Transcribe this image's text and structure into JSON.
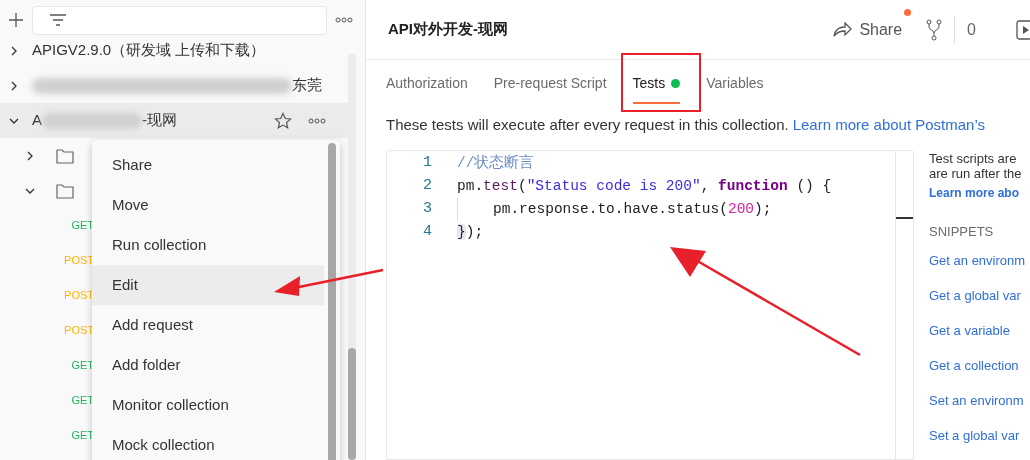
{
  "sidebar": {
    "collections": [
      {
        "name": "APIGV2.9.0（研发域 上传和下载）",
        "expanded": false,
        "selected": false
      },
      {
        "name": "东莞",
        "blurred": true,
        "expanded": false,
        "selected": false
      },
      {
        "name": "A",
        "suffix": "-现网",
        "blurred": true,
        "expanded": true,
        "selected": true,
        "children": [
          {
            "expanded": false
          },
          {
            "expanded": true,
            "children": [
              {
                "method": "GET"
              },
              {
                "method": "POST"
              },
              {
                "method": "POST"
              },
              {
                "method": "POST"
              },
              {
                "method": "GET"
              },
              {
                "method": "GET"
              },
              {
                "method": "GET"
              }
            ]
          }
        ]
      }
    ]
  },
  "context_menu": [
    {
      "label": "Share",
      "selected": false
    },
    {
      "label": "Move",
      "selected": false
    },
    {
      "label": "Run collection",
      "selected": false
    },
    {
      "label": "Edit",
      "selected": true
    },
    {
      "label": "Add request",
      "selected": false
    },
    {
      "label": "Add folder",
      "selected": false
    },
    {
      "label": "Monitor collection",
      "selected": false
    },
    {
      "label": "Mock collection",
      "selected": false
    }
  ],
  "header": {
    "title": "API对外开发-现网",
    "share": {
      "label": "Share",
      "notification": true
    },
    "count": "0"
  },
  "tabs": [
    {
      "label": "Authorization",
      "selected": false,
      "indicator": false
    },
    {
      "label": "Pre-request Script",
      "selected": false,
      "indicator": false
    },
    {
      "label": "Tests",
      "selected": true,
      "indicator": true
    },
    {
      "label": "Variables",
      "selected": false,
      "indicator": false
    }
  ],
  "description": {
    "text": "These tests will execute after every request in this collection.",
    "link": "Learn more about Postman’s"
  },
  "editor": {
    "lines": [
      {
        "number": "1",
        "tokens": [
          {
            "kind": "comment",
            "text": "//状态断言"
          }
        ]
      },
      {
        "number": "2",
        "tokens": [
          {
            "kind": "plain",
            "text": "pm."
          },
          {
            "kind": "method",
            "text": "test"
          },
          {
            "kind": "plain",
            "text": "("
          },
          {
            "kind": "string",
            "text": "\"Status code is 200\""
          },
          {
            "kind": "plain",
            "text": ", "
          },
          {
            "kind": "keyword",
            "text": "function"
          },
          {
            "kind": "plain",
            "text": " () {"
          }
        ]
      },
      {
        "number": "3",
        "indent": true,
        "tokens": [
          {
            "kind": "plain",
            "text": "pm.response.to.have.status("
          },
          {
            "kind": "number",
            "text": "200"
          },
          {
            "kind": "plain",
            "text": ");"
          }
        ]
      },
      {
        "number": "4",
        "tokens": [
          {
            "kind": "bracket",
            "text": "}"
          },
          {
            "kind": "plain",
            "text": ");"
          }
        ]
      }
    ]
  },
  "help": {
    "lines": [
      "Test scripts are",
      "are run after the"
    ],
    "link": "Learn more abo",
    "snippets_title": "SNIPPETS",
    "snippets": [
      "Get an environm",
      "Get a global var",
      "Get a variable",
      "Get a collection",
      "Set an environm",
      "Set a global var"
    ]
  }
}
